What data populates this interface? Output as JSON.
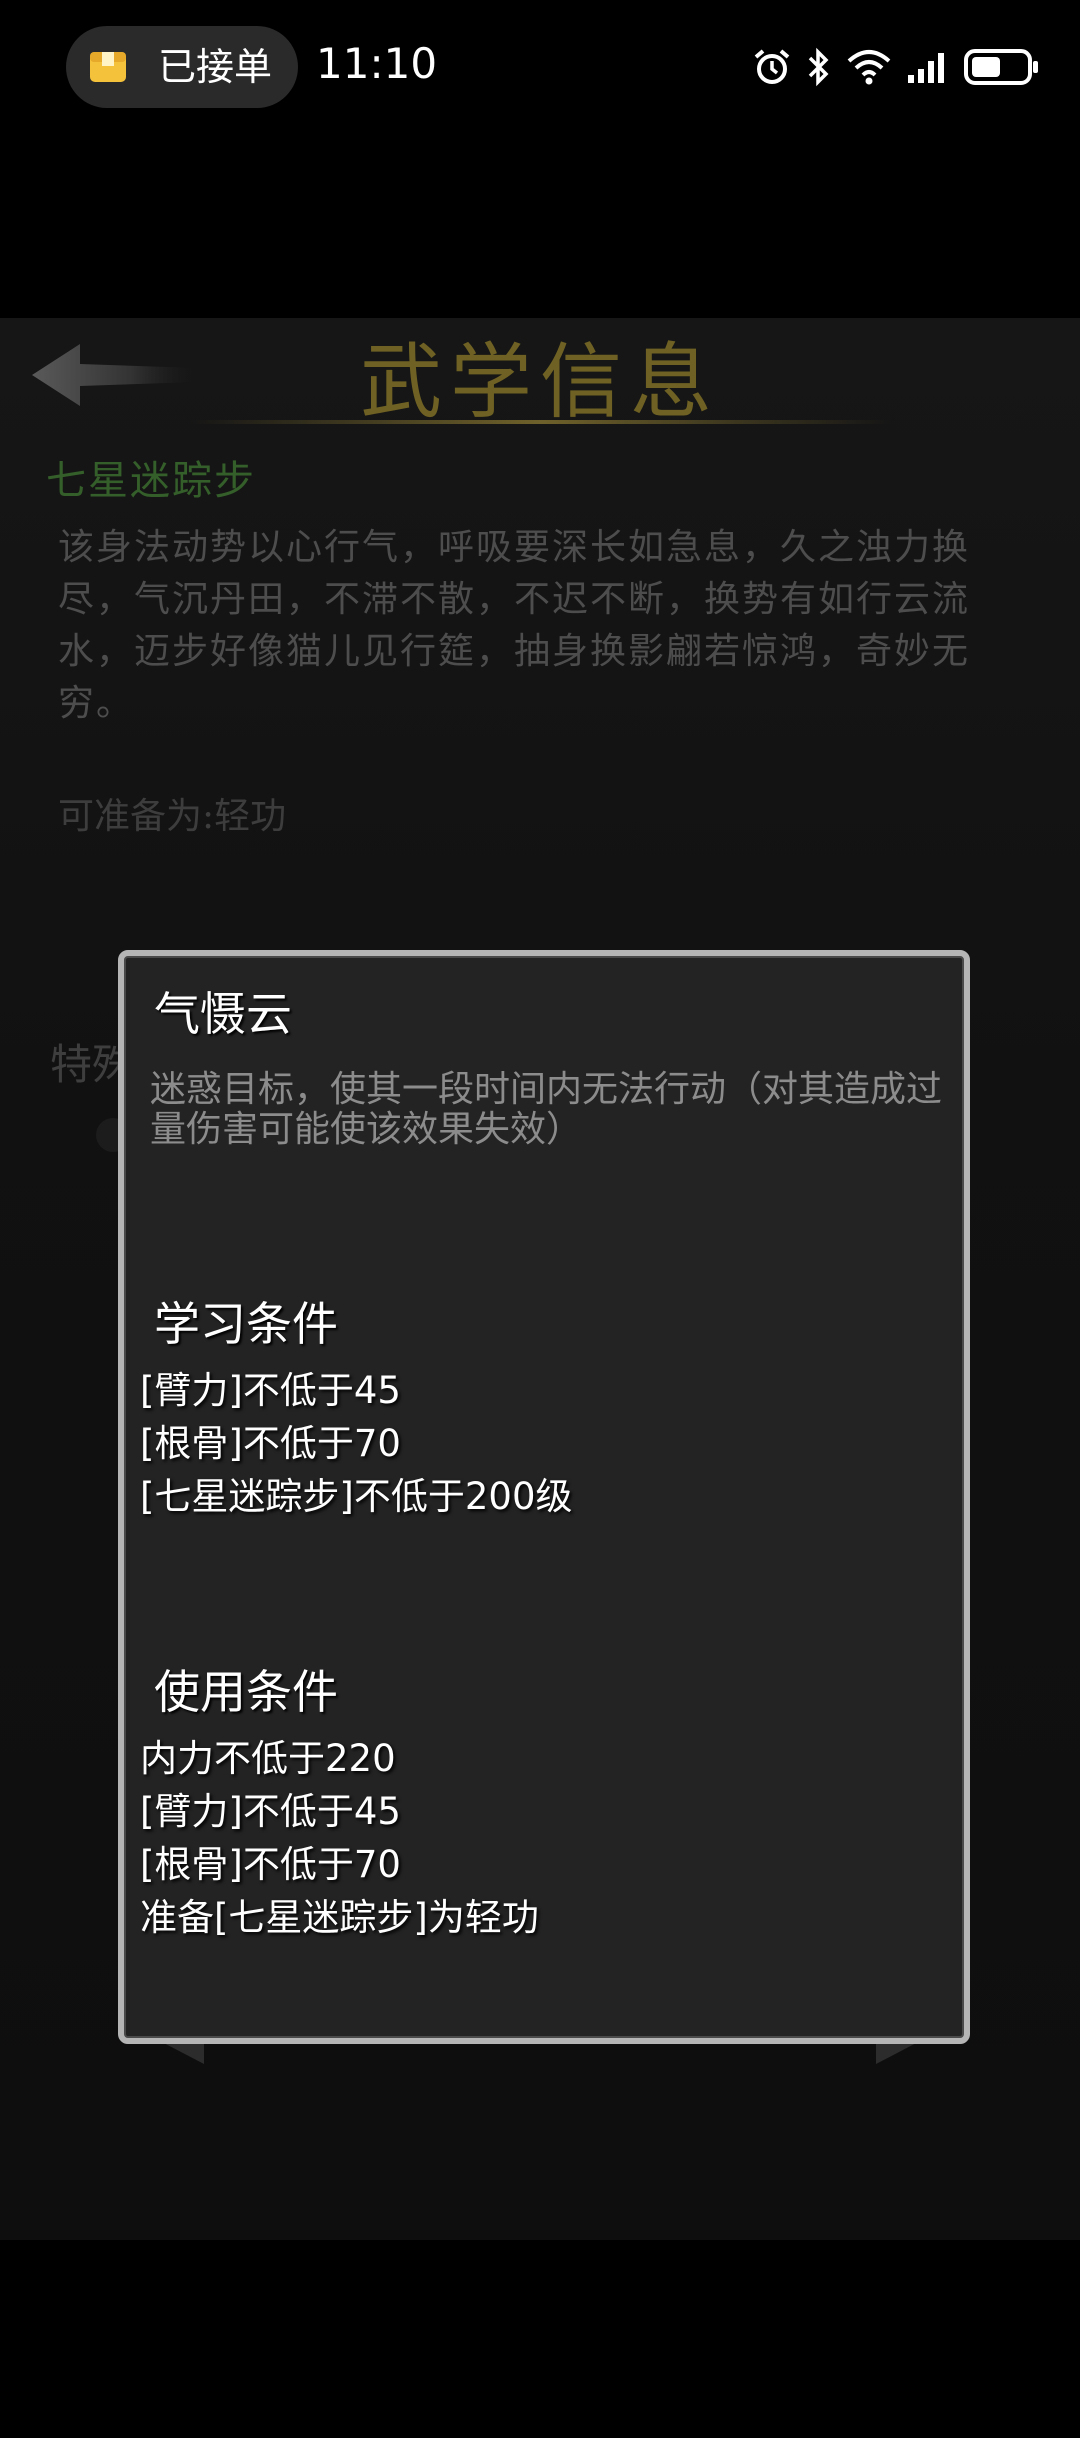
{
  "status_bar": {
    "notification": "已接单",
    "time": "11:10",
    "icons": [
      "alarm-icon",
      "bluetooth-icon",
      "wifi-icon",
      "signal-icon",
      "battery-icon"
    ]
  },
  "header": {
    "title": "武学信息",
    "back_icon": "back-arrow-icon"
  },
  "skill": {
    "name": "七星迷踪步",
    "description": "该身法动势以心行气，呼吸要深长如急息，久之浊力换尽，气沉丹田，不滞不散，不迟不断，换势有如行云流水，迈步好像猫儿见行筵，抽身换影翩若惊鸿，奇妙无穷。",
    "prep": "可准备为:轻功",
    "special_label": "特殊"
  },
  "popup": {
    "title": "气慑云",
    "effect": "迷惑目标，使其一段时间内无法行动（对其造成过量伤害可能使该效果失效）",
    "learn_heading": "学习条件",
    "learn_conditions": [
      "[臂力]不低于45",
      "[根骨]不低于70",
      "[七星迷踪步]不低于200级"
    ],
    "use_heading": "使用条件",
    "use_conditions": [
      "内力不低于220",
      "[臂力]不低于45",
      "[根骨]不低于70",
      "准备[七星迷踪步]为轻功"
    ]
  },
  "colors": {
    "title_gold": "#6e6123",
    "skill_green": "#355f2a",
    "popup_border": "#b5b5b5",
    "popup_bg": "#232323"
  }
}
